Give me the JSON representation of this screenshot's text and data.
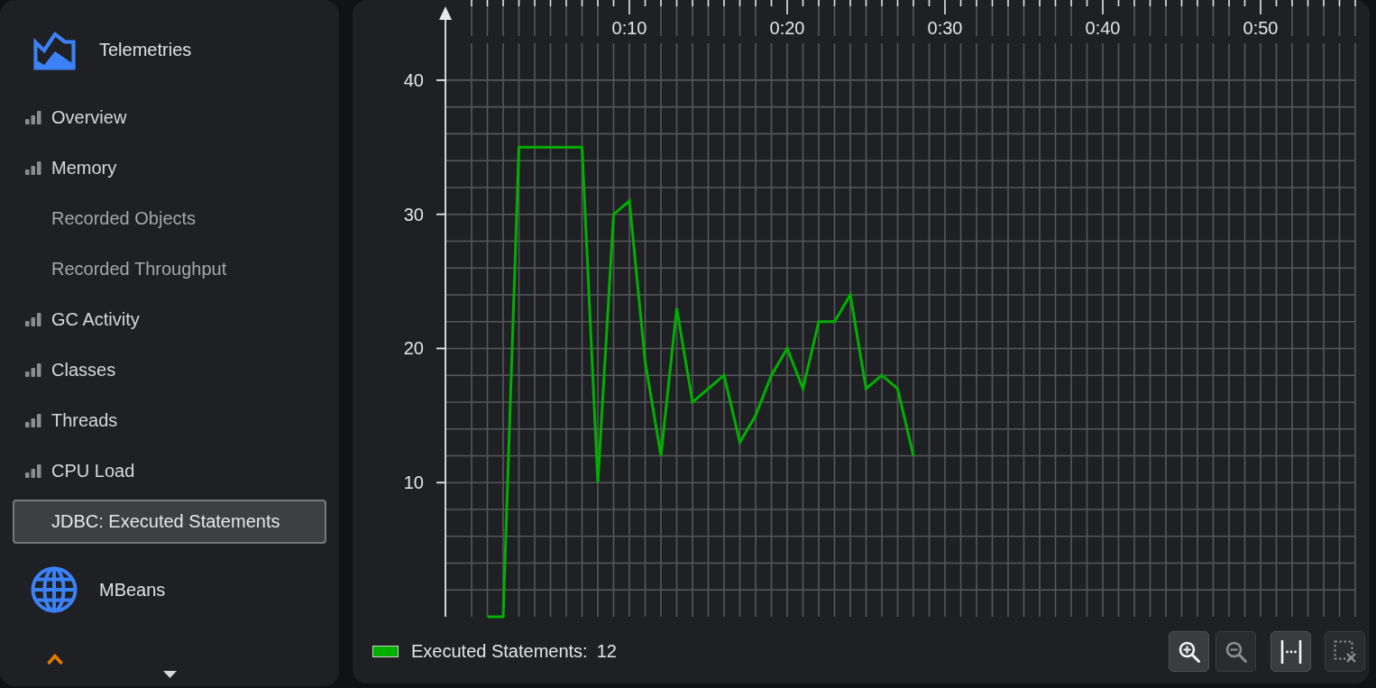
{
  "sidebar": {
    "sections": [
      {
        "kind": "telemetries",
        "title": "Telemetries",
        "items": [
          {
            "label": "Overview",
            "kind": "bars",
            "selected": false
          },
          {
            "label": "Memory",
            "kind": "bars",
            "selected": false
          },
          {
            "label": "Recorded Objects",
            "kind": "plain",
            "selected": false
          },
          {
            "label": "Recorded Throughput",
            "kind": "plain",
            "selected": false
          },
          {
            "label": "GC Activity",
            "kind": "bars",
            "selected": false
          },
          {
            "label": "Classes",
            "kind": "bars",
            "selected": false
          },
          {
            "label": "Threads",
            "kind": "bars",
            "selected": false
          },
          {
            "label": "CPU Load",
            "kind": "bars",
            "selected": false
          },
          {
            "label": "JDBC: Executed Statements",
            "kind": "plain",
            "selected": true
          }
        ]
      },
      {
        "kind": "mbeans",
        "title": "MBeans"
      }
    ]
  },
  "chart_panel": {
    "chart_data": {
      "type": "line",
      "grid": true,
      "x": [
        1,
        2,
        3,
        4,
        5,
        6,
        7,
        8,
        9,
        10,
        11,
        12,
        13,
        14,
        15,
        16,
        17,
        18,
        19,
        20,
        21,
        22,
        23,
        24,
        25,
        26,
        27,
        28
      ],
      "series": [
        {
          "name": "Executed Statements:",
          "color": "#00b000",
          "values": [
            0,
            0,
            35,
            35,
            35,
            35,
            35,
            10,
            30,
            31,
            19,
            12,
            23,
            16,
            17,
            18,
            13,
            15,
            18,
            20,
            17,
            22,
            22,
            24,
            17,
            18,
            17,
            12
          ]
        }
      ],
      "xlim": [
        0,
        56
      ],
      "ylim": [
        0,
        42.75
      ],
      "xticks": [
        {
          "value": 10,
          "label": "0:10"
        },
        {
          "value": 20,
          "label": "0:20"
        },
        {
          "value": 30,
          "label": "0:30"
        },
        {
          "value": 40,
          "label": "0:40"
        },
        {
          "value": 50,
          "label": "0:50"
        }
      ],
      "yticks": [
        10,
        20,
        30,
        40
      ]
    },
    "legend": {
      "value": "12"
    },
    "buttons": [
      {
        "kind": "zoom-in",
        "disabled": false
      },
      {
        "kind": "zoom-out",
        "disabled": true
      },
      {
        "kind": "fit",
        "disabled": false
      },
      {
        "kind": "clear-selection",
        "disabled": true
      }
    ]
  }
}
